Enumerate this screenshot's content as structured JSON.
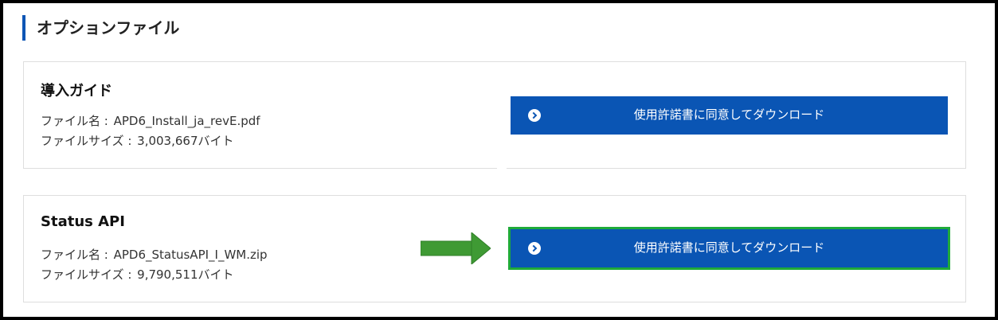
{
  "section": {
    "title": "オプションファイル"
  },
  "files": [
    {
      "title": "導入ガイド",
      "name_label": "ファイル名 :",
      "name_value": "APD6_Install_ja_revE.pdf",
      "size_label": "ファイルサイズ :",
      "size_value": "3,003,667バイト",
      "button_label": "使用許諾書に同意してダウンロード",
      "button_icon": "chevron-right-circle-icon"
    },
    {
      "title": "Status API",
      "name_label": "ファイル名 :",
      "name_value": "APD6_StatusAPI_I_WM.zip",
      "size_label": "ファイルサイズ :",
      "size_value": "9,790,511バイト",
      "button_label": "使用許諾書に同意してダウンロード",
      "button_icon": "chevron-right-circle-icon"
    }
  ],
  "annotation": {
    "arrow_icon": "green-arrow-icon",
    "highlight_color": "#1faa3a"
  },
  "colors": {
    "accent": "#0a55b4",
    "card_border": "#dedede",
    "frame": "#000000"
  }
}
